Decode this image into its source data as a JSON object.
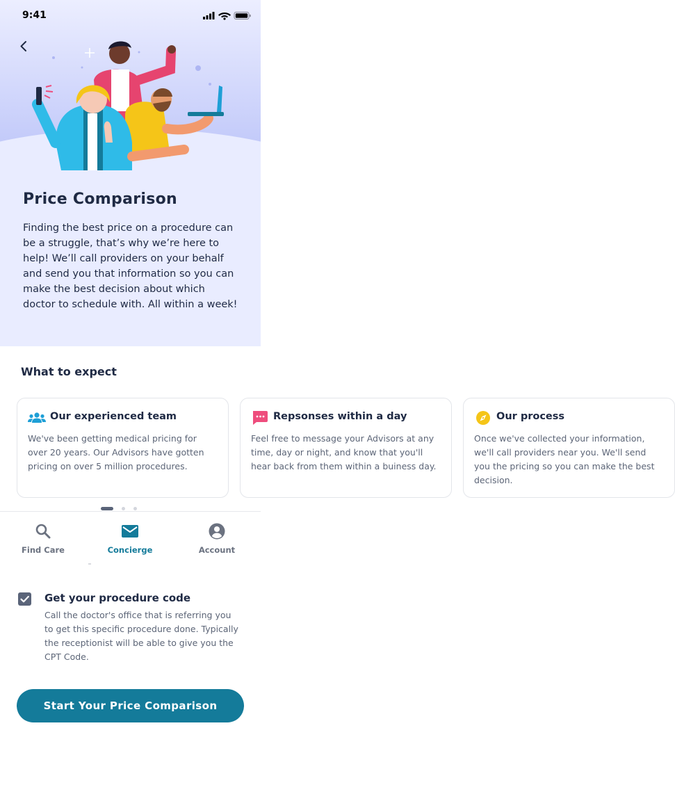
{
  "status_bar": {
    "time": "9:41"
  },
  "hero": {
    "title": "Price Comparison",
    "description": "Finding the best price on a procedure can be a struggle, that’s why we’re here to help! We’ll call providers on your behalf and send you that information so you can make the best decision about which doctor to schedule with. All within a week!",
    "background_color": "#e9ecff"
  },
  "expect": {
    "heading": "What to expect",
    "cards": [
      {
        "icon": "team-icon",
        "title": "Our experienced team",
        "body": "We've been getting medical pricing for over 20 years. Our Advisors have gotten pricing on over 5 million procedures.",
        "icon_color": "#1e9fd6"
      },
      {
        "icon": "chat-icon",
        "title": "Repsonses within a day",
        "body": "Feel free to message your Advisors at any time, day or night, and know that you'll hear back from them within a buiness day.",
        "icon_color": "#ee4d7d"
      },
      {
        "icon": "compass-icon",
        "title": "Our process",
        "body": "Once we've collected your information, we'll call providers near you. We'll send you the pricing so you can make the best decision.",
        "icon_color": "#f5c518"
      }
    ],
    "pager": {
      "current": 1,
      "total": 3
    }
  },
  "tabbar": {
    "tabs": [
      {
        "label": "Find Care",
        "icon": "search-icon",
        "active": false
      },
      {
        "label": "Concierge",
        "icon": "mail-icon",
        "active": true
      },
      {
        "label": "Account",
        "icon": "account-icon",
        "active": false
      }
    ],
    "active_color": "#147b9a"
  },
  "procedure_step": {
    "checked": true,
    "title": "Get your procedure code",
    "body": "Call the doctor's office that is referring you to get this specific procedure done. Typically the receptionist will be able to give you the CPT Code."
  },
  "cta": {
    "label": "Start Your Price Comparison",
    "color": "#147b9a"
  }
}
